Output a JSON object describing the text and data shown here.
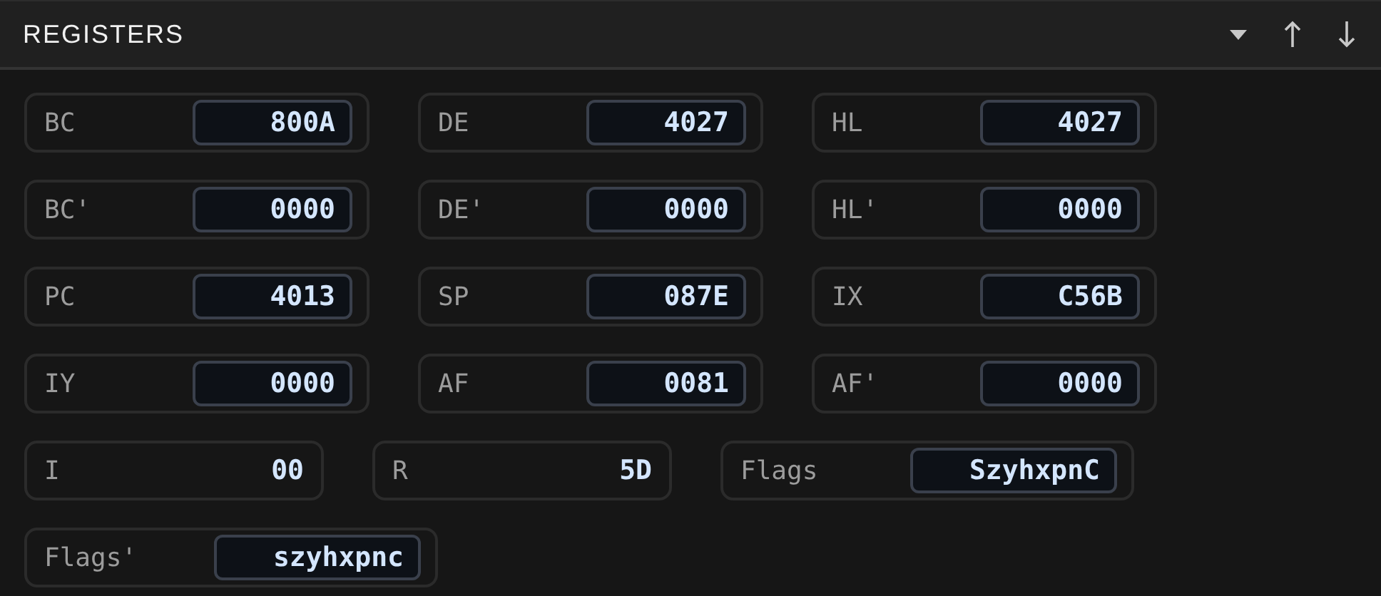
{
  "panel": {
    "title": "REGISTERS"
  },
  "rows": [
    [
      {
        "name": "BC",
        "value": "800A",
        "kind": "word"
      },
      {
        "name": "DE",
        "value": "4027",
        "kind": "word"
      },
      {
        "name": "HL",
        "value": "4027",
        "kind": "word"
      }
    ],
    [
      {
        "name": "BC'",
        "value": "0000",
        "kind": "word"
      },
      {
        "name": "DE'",
        "value": "0000",
        "kind": "word"
      },
      {
        "name": "HL'",
        "value": "0000",
        "kind": "word"
      }
    ],
    [
      {
        "name": "PC",
        "value": "4013",
        "kind": "word"
      },
      {
        "name": "SP",
        "value": "087E",
        "kind": "word"
      },
      {
        "name": "IX",
        "value": "C56B",
        "kind": "word"
      }
    ],
    [
      {
        "name": "IY",
        "value": "0000",
        "kind": "word"
      },
      {
        "name": "AF",
        "value": "0081",
        "kind": "word"
      },
      {
        "name": "AF'",
        "value": "0000",
        "kind": "word"
      }
    ],
    [
      {
        "name": "I",
        "value": "00",
        "kind": "byte"
      },
      {
        "name": "R",
        "value": "5D",
        "kind": "byte"
      },
      {
        "name": "Flags",
        "value": "SzyhxpnC",
        "kind": "flags"
      }
    ],
    [
      {
        "name": "Flags'",
        "value": "szyhxpnc",
        "kind": "flags"
      }
    ]
  ]
}
